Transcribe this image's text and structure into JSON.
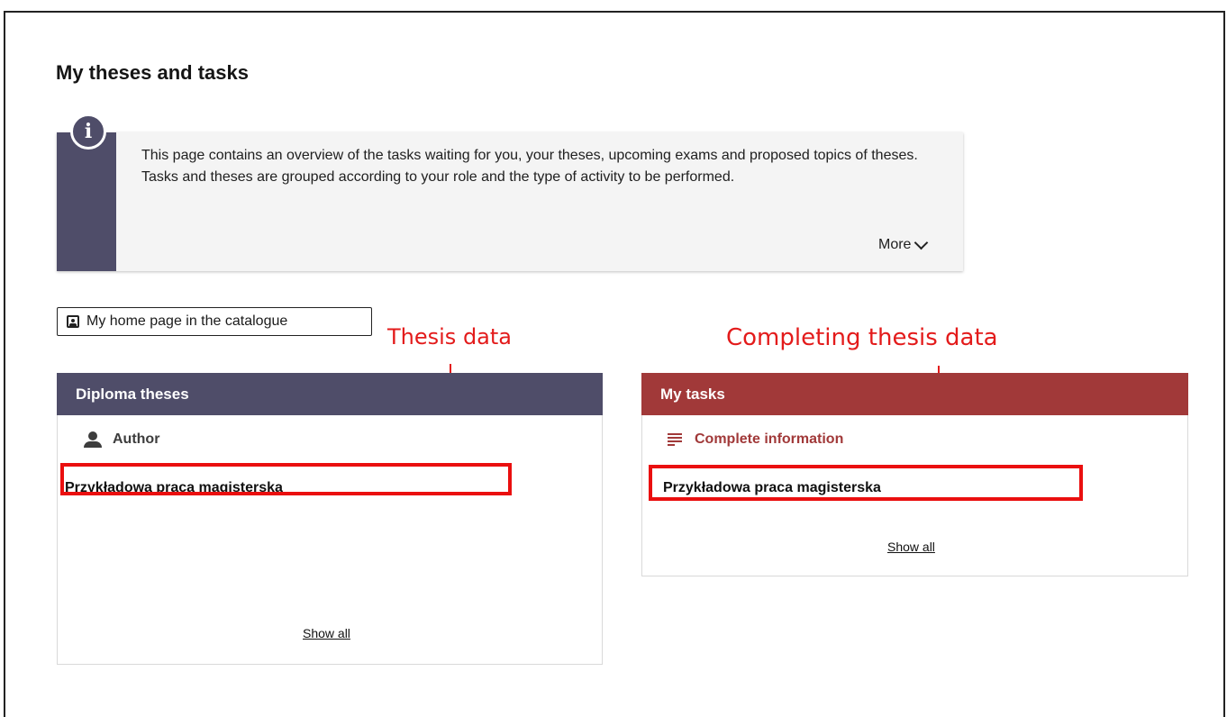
{
  "page": {
    "title": "My theses and tasks"
  },
  "info": {
    "text": "This page contains an overview of the tasks waiting for you, your theses, upcoming exams and proposed topics of theses. Tasks and theses are grouped according to your role and the type of activity to be performed.",
    "more_label": "More"
  },
  "catalogue_button": {
    "label": "My home page in the catalogue"
  },
  "annotations": {
    "left": "Thesis data",
    "right": "Completing thesis data"
  },
  "diploma_panel": {
    "title": "Diploma theses",
    "group_label": "Author",
    "item_title": "Przykładowa praca magisterska",
    "show_all": "Show all"
  },
  "tasks_panel": {
    "title": "My tasks",
    "group_label": "Complete information",
    "item_title": "Przykładowa praca magisterska",
    "show_all": "Show all"
  },
  "colors": {
    "primary": "#4f4d69",
    "tasks_red": "#a13939",
    "annotation_red": "#e31b1b"
  }
}
